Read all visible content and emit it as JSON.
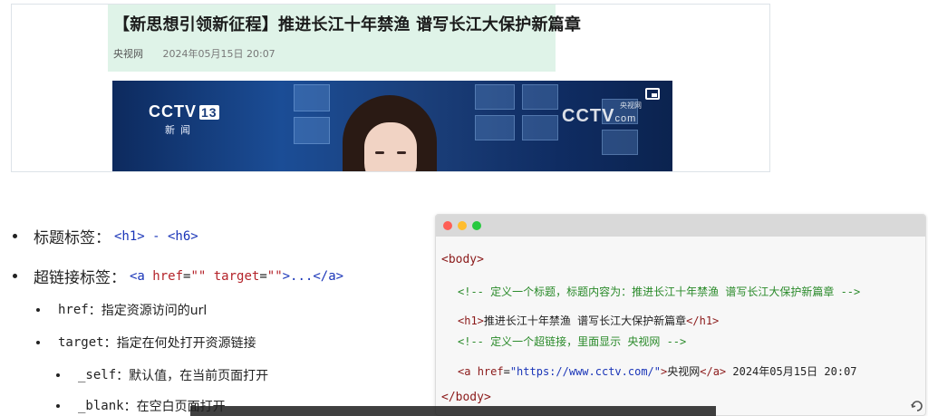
{
  "news": {
    "title": "【新思想引领新征程】推进长江十年禁渔 谱写长江大保护新篇章",
    "source": "央视网",
    "datetime": "2024年05月15日 20:07",
    "video": {
      "channel_logo_left": "CCTV",
      "channel_number": "13",
      "channel_sub": "新闻",
      "watermark": "CCTV",
      "watermark_sub": "com",
      "watermark_cn": "央视网"
    }
  },
  "bullets": {
    "item1": {
      "label": "标题标签：",
      "code": "<h1> - <h6>"
    },
    "item2": {
      "label": "超链接标签：",
      "code_parts": [
        "<a ",
        "href",
        "=",
        "\"\"",
        " ",
        "target",
        "=",
        "\"\"",
        ">...</a>"
      ]
    },
    "item2_sub1": {
      "name": "href",
      "desc": "：指定资源访问的url"
    },
    "item2_sub2": {
      "name": "target",
      "desc": "：指定在何处打开资源链接"
    },
    "item2_sub2_a": {
      "name": "_self",
      "desc": "：默认值，在当前页面打开"
    },
    "item2_sub2_b": {
      "name": "_blank",
      "desc": "：在空白页面打开"
    }
  },
  "code": {
    "line1": "<body>",
    "line2": "<!-- 定义一个标题，标题内容为：推进长江十年禁渔 谱写长江大保护新篇章 -->",
    "line3_open": "<h1>",
    "line3_text": "推进长江十年禁渔 谱写长江大保护新篇章",
    "line3_close": "</h1>",
    "line4": "<!-- 定义一个超链接，里面显示 央视网 -->",
    "line5_open": "<a ",
    "line5_attr": "href",
    "line5_eq": "=",
    "line5_val": "\"https://www.cctv.com/\"",
    "line5_gt": ">",
    "line5_text": "央视网",
    "line5_close": "</a>",
    "line5_after": " 2024年05月15日 20:07",
    "line6": "</body>"
  },
  "colors": {
    "header_bg": "#dff3e8",
    "code_tag": "#8b1a1a",
    "code_comment": "#2a8a2a",
    "code_string": "#1a35b8"
  },
  "icons": [
    "picture-in-picture-icon",
    "resize-icon"
  ]
}
